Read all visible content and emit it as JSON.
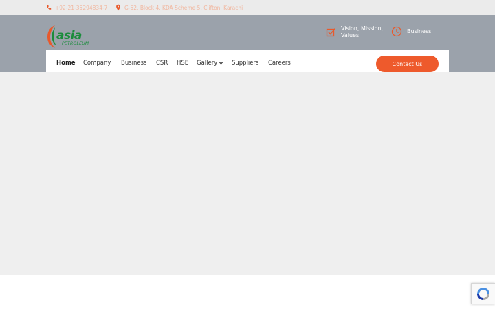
{
  "topbar": {
    "phone": "+92-21-35294834-7",
    "address": "G-52, Block 4, KDA Scheme 5, Clifton, Karachi",
    "phone_icon": "phone-icon",
    "address_icon": "map-pin-icon"
  },
  "logo": {
    "brand": "asia",
    "tagline": "PETROLEUM"
  },
  "features": [
    {
      "label": "Vision, Mission, Values",
      "icon": "checkbox-icon"
    },
    {
      "label": "Business",
      "icon": "clock-icon"
    }
  ],
  "nav": {
    "items": [
      {
        "label": "Home",
        "active": true
      },
      {
        "label": "Company"
      },
      {
        "label": "Business"
      },
      {
        "label": "CSR"
      },
      {
        "label": "HSE"
      },
      {
        "label": "Gallery",
        "has_dropdown": true
      },
      {
        "label": "Suppliers"
      },
      {
        "label": "Careers"
      }
    ],
    "contact_label": "Contact Us"
  },
  "colors": {
    "accent": "#ee5a2c",
    "brand_green": "#1a8c3b",
    "header_bg": "#9ba2ab",
    "content_bg": "#efefef"
  }
}
